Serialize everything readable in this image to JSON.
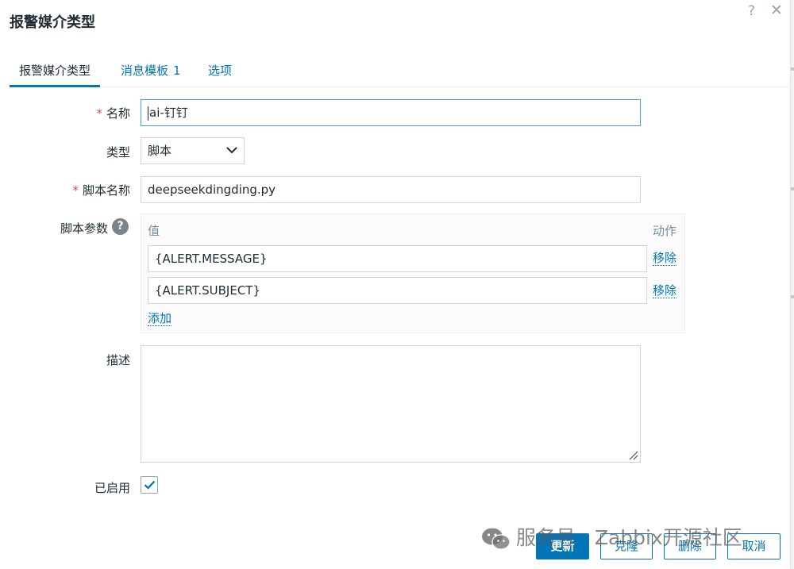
{
  "dialog": {
    "title": "报警媒介类型",
    "help_glyph": "?",
    "close_glyph": "✕"
  },
  "tabs": [
    {
      "label": "报警媒介类型",
      "badge": ""
    },
    {
      "label": "消息模板",
      "badge": "1"
    },
    {
      "label": "选项",
      "badge": ""
    }
  ],
  "form": {
    "required_marker": "*",
    "name": {
      "label": "名称",
      "value": "ai-钉钉"
    },
    "type": {
      "label": "类型",
      "selected": "脚本"
    },
    "script_name": {
      "label": "脚本名称",
      "value": "deepseekdingding.py"
    },
    "script_params": {
      "label": "脚本参数",
      "help_glyph": "?",
      "value_header": "值",
      "action_header": "动作",
      "rows": [
        {
          "value": "{ALERT.MESSAGE}",
          "remove_label": "移除"
        },
        {
          "value": "{ALERT.SUBJECT}",
          "remove_label": "移除"
        }
      ],
      "add_label": "添加"
    },
    "description": {
      "label": "描述",
      "value": ""
    },
    "enabled": {
      "label": "已启用",
      "checked": true
    }
  },
  "buttons": {
    "update": "更新",
    "clone": "克隆",
    "delete": "删除",
    "cancel": "取消"
  },
  "watermark": {
    "text": "服务号 · Zabbix开源社区",
    "icon": "wechat-icon"
  },
  "colors": {
    "accent": "#0275b8",
    "required": "#d64e4e",
    "text": "#1f2c33",
    "muted": "#768d99"
  }
}
